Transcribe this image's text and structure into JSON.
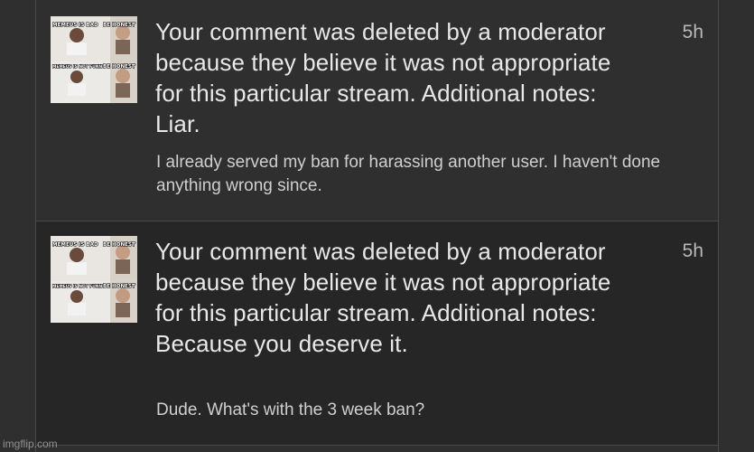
{
  "notifications": [
    {
      "thumbnail": {
        "top_left_caption": "MEMEUS IS BAD",
        "top_right_caption": "BE HONEST",
        "bottom_left_caption": "MEMEUS IS NOT FUNNY",
        "bottom_right_caption": "BE HONEST"
      },
      "message": "Your comment was deleted by a moderator because they believe it was not appropriate for this particular stream. Additional notes: Liar.",
      "reply": "I already served my ban for harassing another user. I haven't done anything wrong since.",
      "time": "5h"
    },
    {
      "thumbnail": {
        "top_left_caption": "MEMEUS IS BAD",
        "top_right_caption": "BE HONEST",
        "bottom_left_caption": "MEMEUS IS NOT FUNNY",
        "bottom_right_caption": "BE HONEST"
      },
      "message": "Your comment was deleted by a moderator because they believe it was not appropriate for this particular stream. Additional notes: Because you deserve it.",
      "reply": "Dude. What's with the 3 week ban?",
      "time": "5h"
    }
  ],
  "watermark": "imgflip.com"
}
